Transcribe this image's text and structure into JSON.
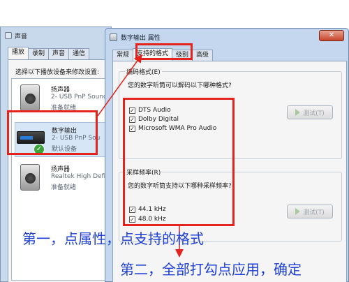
{
  "sound_window": {
    "title": "声音",
    "tabs": [
      "播放",
      "录制",
      "声音",
      "通信"
    ],
    "instruction": "选择以下播放设备来修改设置:",
    "devices": [
      {
        "name": "扬声器",
        "sub": "2- USB PnP Sound",
        "status": "准备就绪",
        "icon": "speaker-icon"
      },
      {
        "name": "数字输出",
        "sub": "2- USB PnP Sou",
        "status": "默认设备",
        "icon": "digital-output-icon",
        "selected": true
      },
      {
        "name": "扬声器",
        "sub": "Realtek High Defi",
        "status": "准备就绪",
        "icon": "speaker-icon"
      }
    ]
  },
  "properties_window": {
    "title": "数字输出 属性",
    "close_glyph": "✕",
    "tabs": [
      "常规",
      "支持的格式",
      "级别",
      "高级"
    ],
    "active_tab": "支持的格式",
    "encoding": {
      "title": "编码格式(E)",
      "question": "您的数字听筒可以解码以下哪种格式?",
      "options": [
        {
          "label": "DTS Audio",
          "checked": true
        },
        {
          "label": "Dolby Digital",
          "checked": true
        },
        {
          "label": "Microsoft WMA Pro Audio",
          "checked": true
        }
      ],
      "test_label": "测试(T)"
    },
    "sample_rate": {
      "title": "采样频率(R)",
      "question": "您的数字听筒支持以下哪种采样频率?",
      "options": [
        {
          "label": "44.1 kHz",
          "checked": true
        },
        {
          "label": "48.0 kHz",
          "checked": true
        }
      ],
      "test_label": "测试(T)"
    }
  },
  "annotations": {
    "step1": "第一，点属性，点支持的格式",
    "step2": "第二，全部打勾点应用，确定",
    "color": "#1e3fd8",
    "highlight_color": "#e3231c"
  }
}
